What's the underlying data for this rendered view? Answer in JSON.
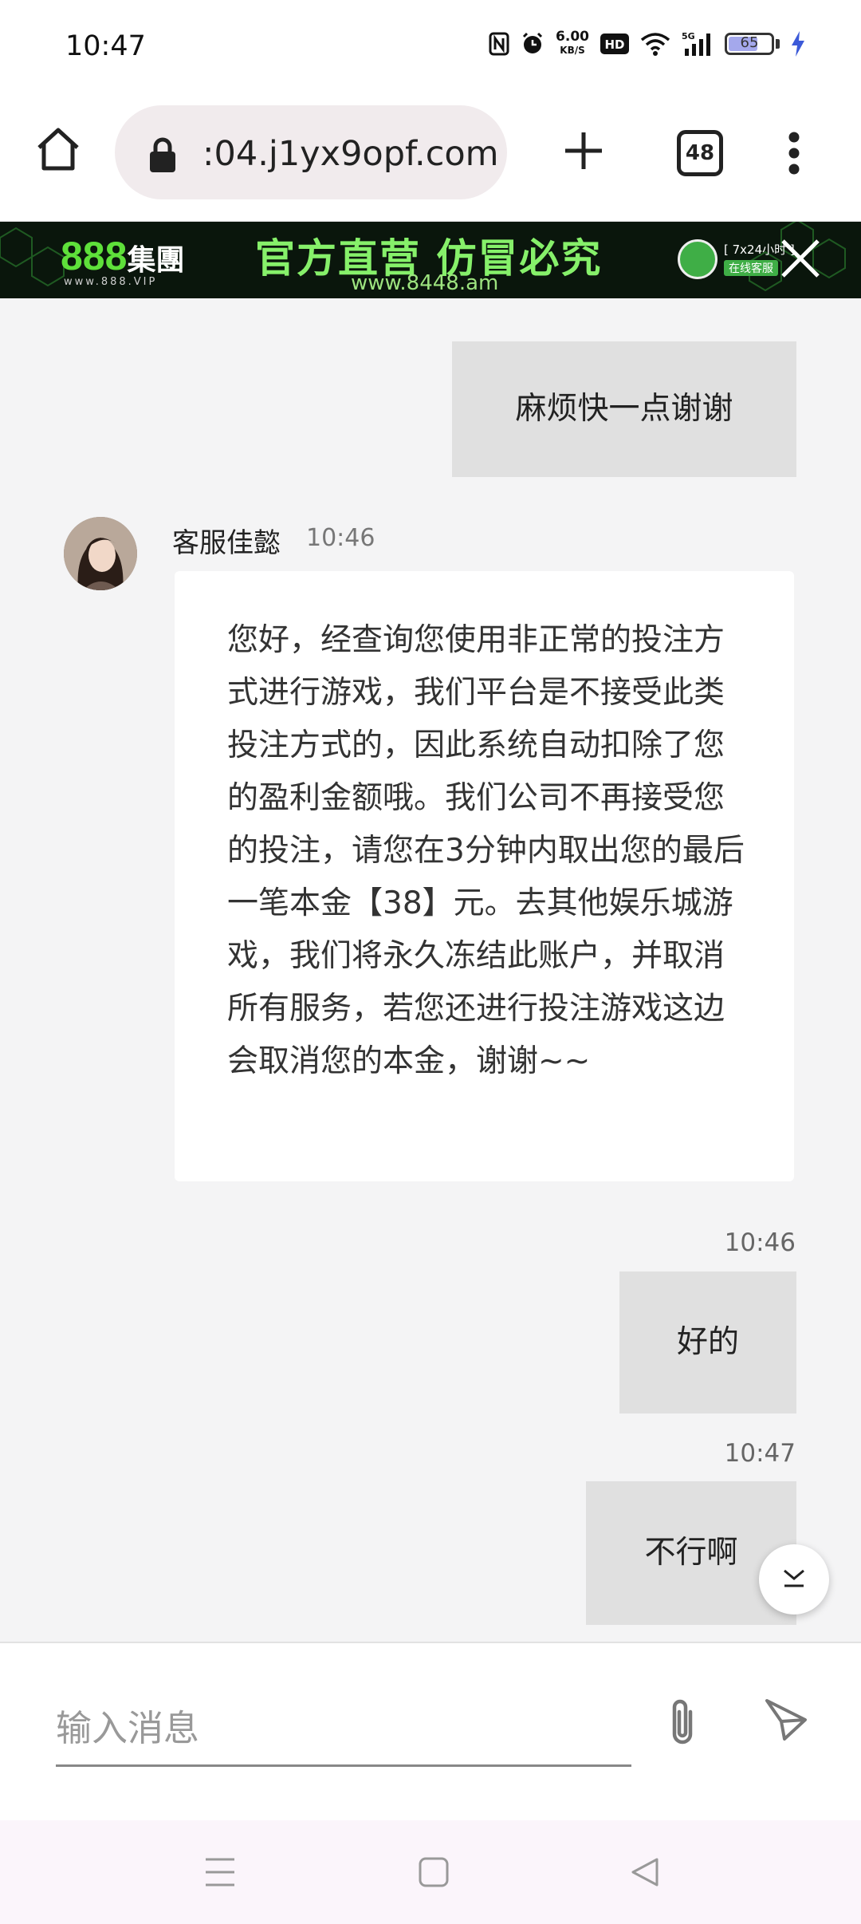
{
  "status_bar": {
    "time": "10:47",
    "net_speed_value": "6.00",
    "net_speed_unit": "KB/S",
    "hd_label": "HD",
    "signal_label": "5G",
    "battery_level": "65",
    "icons": [
      "nfc-icon",
      "alarm-icon",
      "wifi-icon",
      "signal-icon",
      "battery-icon",
      "charging-icon"
    ]
  },
  "browser": {
    "url": ":04.j1yx9opf.com",
    "tab_count": "48"
  },
  "banner": {
    "logo_number": "888",
    "logo_text": "集團",
    "logo_sub": "www.888.VIP",
    "slogan": "官方直营 仿冒必究",
    "url": "www.8448.am",
    "cs_line1": "[ 7x24小时 ]",
    "cs_line2": "在线客服"
  },
  "chat": {
    "messages": [
      {
        "direction": "out",
        "text": "麻烦快一点谢谢"
      },
      {
        "direction": "in",
        "sender": "客服佳懿",
        "time": "10:46",
        "text": "您好，经查询您使用非正常的投注方式进行游戏，我们平台是不接受此类投注方式的，因此系统自动扣除了您的盈利金额哦。我们公司不再接受您的投注，请您在3分钟内取出您的最后一笔本金【38】元。去其他娱乐城游戏，我们将永久冻结此账户，并取消所有服务，若您还进行投注游戏这边会取消您的本金，谢谢~~"
      },
      {
        "direction": "out",
        "time": "10:46",
        "text": "好的"
      },
      {
        "direction": "out",
        "time": "10:47",
        "text": "不行啊"
      }
    ]
  },
  "input": {
    "placeholder": "输入消息"
  },
  "colors": {
    "chat_background": "#f4f4f5",
    "outgoing_bubble": "#e0e0e0",
    "incoming_bubble": "#ffffff",
    "banner_background": "#0a160c",
    "banner_accent": "#86f06a"
  }
}
